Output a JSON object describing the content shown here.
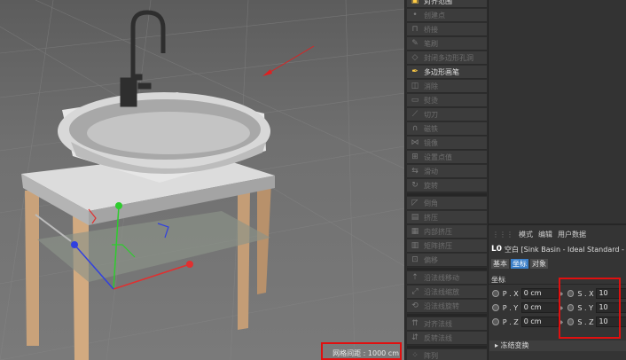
{
  "viewport": {
    "grid_spacing_label": "网格间距 : 1000 cm"
  },
  "palette": {
    "tools": [
      {
        "label": "对齐范围",
        "icon": "align-range-icon",
        "active": true
      },
      {
        "label": "创建点",
        "icon": "create-point-icon",
        "active": false
      },
      {
        "label": "桥接",
        "icon": "bridge-icon",
        "active": false
      },
      {
        "label": "笔刷",
        "icon": "brush-icon",
        "active": false
      },
      {
        "label": "封闭多边形孔洞",
        "icon": "close-hole-icon",
        "active": false
      },
      {
        "label": "多边形画笔",
        "icon": "polygon-pen-icon",
        "active": true
      },
      {
        "label": "消除",
        "icon": "dissolve-icon",
        "active": false
      },
      {
        "label": "熨烫",
        "icon": "iron-icon",
        "active": false
      },
      {
        "label": "切刀",
        "icon": "knife-icon",
        "active": false
      },
      {
        "label": "磁铁",
        "icon": "magnet-icon",
        "active": false
      },
      {
        "label": "镜像",
        "icon": "mirror-icon",
        "active": false
      },
      {
        "label": "设置点值",
        "icon": "set-point-icon",
        "active": false
      },
      {
        "label": "滑动",
        "icon": "slide-icon",
        "active": false
      },
      {
        "label": "旋转",
        "icon": "spin-edge-icon",
        "active": false
      },
      {
        "label": "倒角",
        "icon": "bevel-icon",
        "active": false
      },
      {
        "label": "挤压",
        "icon": "extrude-icon",
        "active": false
      },
      {
        "label": "内部挤压",
        "icon": "extrude-inner-icon",
        "active": false
      },
      {
        "label": "矩阵挤压",
        "icon": "matrix-extrude-icon",
        "active": false
      },
      {
        "label": "偏移",
        "icon": "offset-icon",
        "active": false
      },
      {
        "label": "沿法线移动",
        "icon": "normal-move-icon",
        "active": false
      },
      {
        "label": "沿法线缩放",
        "icon": "normal-scale-icon",
        "active": false
      },
      {
        "label": "沿法线旋转",
        "icon": "normal-rotate-icon",
        "active": false
      },
      {
        "label": "对齐法线",
        "icon": "align-normal-icon",
        "active": false
      },
      {
        "label": "反转法线",
        "icon": "reverse-normal-icon",
        "active": false
      },
      {
        "label": "阵列",
        "icon": "array-icon",
        "active": false
      },
      {
        "label": "克隆",
        "icon": "clone-icon",
        "active": false
      }
    ]
  },
  "attributes": {
    "menu": [
      "模式",
      "编辑",
      "用户数据"
    ],
    "object_type": "L0",
    "object_name": "空白 [Sink Basin - Ideal Standard - Celia",
    "tabs": [
      {
        "label": "基本",
        "selected": false
      },
      {
        "label": "坐标",
        "selected": true
      },
      {
        "label": "对象",
        "selected": false
      }
    ],
    "section": "坐标",
    "position": [
      {
        "label": "P . X",
        "value": "0 cm"
      },
      {
        "label": "P . Y",
        "value": "0 cm"
      },
      {
        "label": "P . Z",
        "value": "0 cm"
      }
    ],
    "scale": [
      {
        "label": "S . X",
        "value": "10"
      },
      {
        "label": "S . Y",
        "value": "10"
      },
      {
        "label": "S . Z",
        "value": "10"
      }
    ],
    "freeze_label": "▸ 冻结变换"
  }
}
